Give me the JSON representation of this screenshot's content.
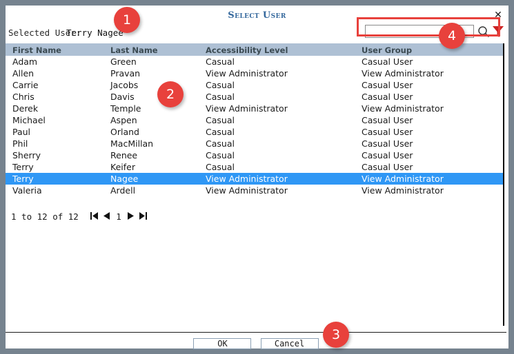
{
  "window": {
    "title": "Select User",
    "close_icon": "close-x-icon",
    "frame_color": "#76838f"
  },
  "selected_user": {
    "label": "Selected User:",
    "value": "Terry Nagee"
  },
  "search": {
    "value": "",
    "placeholder": "",
    "search_icon": "magnifier-icon",
    "filter_icon": "funnel-filter-icon",
    "filter_icon_color": "#cc2222"
  },
  "table": {
    "columns": [
      "First Name",
      "Last Name",
      "Accessibility Level",
      "User Group"
    ],
    "header_bg": "#aec0d4",
    "selected_row_bg": "#2f97f5",
    "selected_index": 10,
    "rows": [
      [
        "Adam",
        "Green",
        "Casual",
        "Casual User"
      ],
      [
        "Allen",
        "Pravan",
        "View Administrator",
        "View Administrator"
      ],
      [
        "Carrie",
        "Jacobs",
        "Casual",
        "Casual User"
      ],
      [
        "Chris",
        "Davis",
        "Casual",
        "Casual User"
      ],
      [
        "Derek",
        "Temple",
        "View Administrator",
        "View Administrator"
      ],
      [
        "Michael",
        "Aspen",
        "Casual",
        "Casual User"
      ],
      [
        "Paul",
        "Orland",
        "Casual",
        "Casual User"
      ],
      [
        "Phil",
        "MacMillan",
        "Casual",
        "Casual User"
      ],
      [
        "Sherry",
        "Renee",
        "Casual",
        "Casual User"
      ],
      [
        "Terry",
        "Keifer",
        "Casual",
        "Casual User"
      ],
      [
        "Terry",
        "Nagee",
        "View Administrator",
        "View Administrator"
      ],
      [
        "Valeria",
        "Ardell",
        "View Administrator",
        "View Administrator"
      ]
    ]
  },
  "pagination": {
    "range_text": "1 to 12 of 12",
    "page_number": "1",
    "first_icon": "first-page-icon",
    "prev_icon": "previous-page-icon",
    "next_icon": "next-page-icon",
    "last_icon": "last-page-icon"
  },
  "footer": {
    "ok_label": "OK",
    "cancel_label": "Cancel"
  },
  "annotations": {
    "badge_color": "#e8413c",
    "items": [
      {
        "number": "1"
      },
      {
        "number": "2"
      },
      {
        "number": "3"
      },
      {
        "number": "4"
      }
    ]
  }
}
